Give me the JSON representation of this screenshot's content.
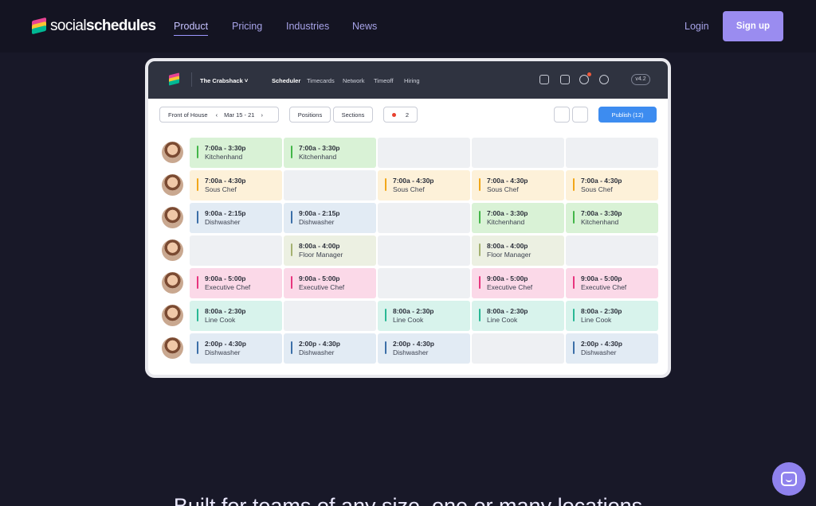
{
  "nav": {
    "brand_light": "social",
    "brand_bold": "schedules",
    "links": [
      "Product",
      "Pricing",
      "Industries",
      "News"
    ],
    "login": "Login",
    "signup": "Sign up"
  },
  "app": {
    "workspace": "The Crabshack ˅",
    "tabs": [
      "Scheduler",
      "Timecards",
      "Network",
      "Timeoff",
      "Hiring"
    ],
    "version": "v4.2",
    "toolbar": {
      "location": "Front of House",
      "prev": "‹",
      "date_range": "Mar 15 - 21",
      "next": "›",
      "positions": "Positions",
      "sections": "Sections",
      "alert_count": "2",
      "publish": "Publish (12)"
    },
    "rows": [
      {
        "shifts": [
          {
            "time": "7:00a - 3:30p",
            "role": "Kitchenhand",
            "color": "#d9f2d6",
            "bar": "#43b649"
          },
          {
            "time": "7:00a - 3:30p",
            "role": "Kitchenhand",
            "color": "#d9f2d6",
            "bar": "#43b649"
          },
          null,
          null,
          null
        ]
      },
      {
        "shifts": [
          {
            "time": "7:00a - 4:30p",
            "role": "Sous Chef",
            "color": "#fdf1d9",
            "bar": "#f2a719"
          },
          null,
          {
            "time": "7:00a - 4:30p",
            "role": "Sous Chef",
            "color": "#fdf1d9",
            "bar": "#f2a719"
          },
          {
            "time": "7:00a - 4:30p",
            "role": "Sous Chef",
            "color": "#fdf1d9",
            "bar": "#f2a719"
          },
          {
            "time": "7:00a - 4:30p",
            "role": "Sous Chef",
            "color": "#fdf1d9",
            "bar": "#f2a719"
          }
        ]
      },
      {
        "shifts": [
          {
            "time": "9:00a - 2:15p",
            "role": "Dishwasher",
            "color": "#e2ebf4",
            "bar": "#3c6fa8"
          },
          {
            "time": "9:00a - 2:15p",
            "role": "Dishwasher",
            "color": "#e2ebf4",
            "bar": "#3c6fa8"
          },
          null,
          {
            "time": "7:00a - 3:30p",
            "role": "Kitchenhand",
            "color": "#d9f2d6",
            "bar": "#43b649"
          },
          {
            "time": "7:00a - 3:30p",
            "role": "Kitchenhand",
            "color": "#d9f2d6",
            "bar": "#43b649"
          }
        ]
      },
      {
        "shifts": [
          null,
          {
            "time": "8:00a - 4:00p",
            "role": "Floor Manager",
            "color": "#ecf0e2",
            "bar": "#a4b170"
          },
          null,
          {
            "time": "8:00a - 4:00p",
            "role": "Floor Manager",
            "color": "#ecf0e2",
            "bar": "#a4b170"
          },
          null
        ]
      },
      {
        "shifts": [
          {
            "time": "9:00a - 5:00p",
            "role": "Executive Chef",
            "color": "#fbd9e8",
            "bar": "#e8357e"
          },
          {
            "time": "9:00a - 5:00p",
            "role": "Executive Chef",
            "color": "#fbd9e8",
            "bar": "#e8357e"
          },
          null,
          {
            "time": "9:00a - 5:00p",
            "role": "Executive Chef",
            "color": "#fbd9e8",
            "bar": "#e8357e"
          },
          {
            "time": "9:00a - 5:00p",
            "role": "Executive Chef",
            "color": "#fbd9e8",
            "bar": "#e8357e"
          }
        ]
      },
      {
        "shifts": [
          {
            "time": "8:00a - 2:30p",
            "role": "Line Cook",
            "color": "#d8f3ec",
            "bar": "#29b894"
          },
          null,
          {
            "time": "8:00a - 2:30p",
            "role": "Line Cook",
            "color": "#d8f3ec",
            "bar": "#29b894"
          },
          {
            "time": "8:00a - 2:30p",
            "role": "Line Cook",
            "color": "#d8f3ec",
            "bar": "#29b894"
          },
          {
            "time": "8:00a - 2:30p",
            "role": "Line Cook",
            "color": "#d8f3ec",
            "bar": "#29b894"
          }
        ]
      },
      {
        "shifts": [
          {
            "time": "2:00p - 4:30p",
            "role": "Dishwasher",
            "color": "#e2ebf4",
            "bar": "#3c6fa8"
          },
          {
            "time": "2:00p - 4:30p",
            "role": "Dishwasher",
            "color": "#e2ebf4",
            "bar": "#3c6fa8"
          },
          {
            "time": "2:00p - 4:30p",
            "role": "Dishwasher",
            "color": "#e2ebf4",
            "bar": "#3c6fa8"
          },
          null,
          {
            "time": "2:00p - 4:30p",
            "role": "Dishwasher",
            "color": "#e2ebf4",
            "bar": "#3c6fa8"
          }
        ]
      }
    ]
  },
  "headline": "Built for teams of any size, one or many locations",
  "chat_icon": "chat-bubble-icon"
}
